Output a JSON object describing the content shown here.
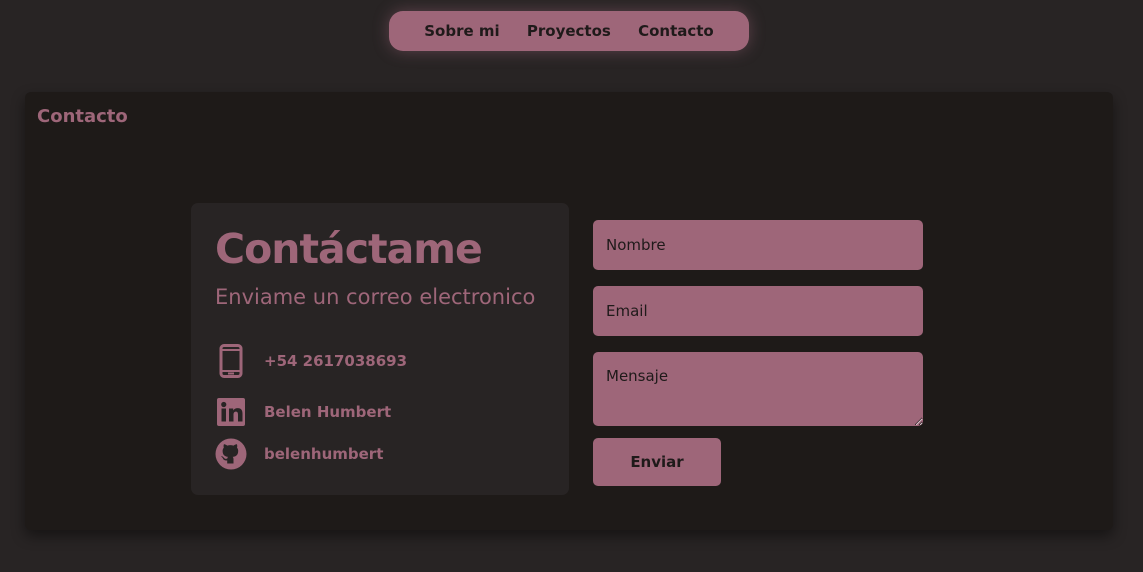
{
  "nav": {
    "items": [
      {
        "label": "Sobre mi"
      },
      {
        "label": "Proyectos"
      },
      {
        "label": "Contacto"
      }
    ]
  },
  "section": {
    "title": "Contacto"
  },
  "card": {
    "heading": "Contáctame",
    "subheading": "Enviame un correo electronico",
    "contacts": [
      {
        "icon": "phone-icon",
        "text": "+54 2617038693"
      },
      {
        "icon": "linkedin-icon",
        "text": "Belen Humbert"
      },
      {
        "icon": "github-icon",
        "text": "belenhumbert"
      }
    ]
  },
  "form": {
    "name_placeholder": "Nombre",
    "email_placeholder": "Email",
    "message_placeholder": "Mensaje",
    "submit_label": "Enviar"
  },
  "colors": {
    "background": "#282424",
    "panel": "#1e1a18",
    "accent": "#9e6679",
    "text_dark": "#1f1a1a"
  }
}
